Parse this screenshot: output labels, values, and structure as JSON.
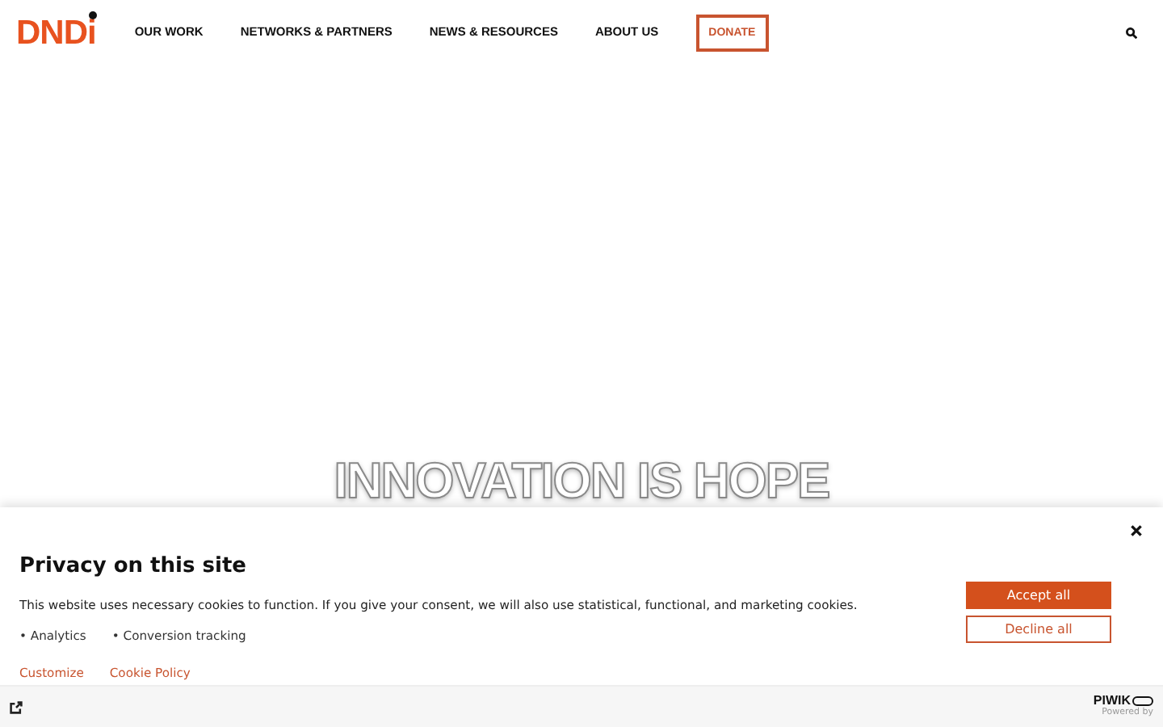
{
  "header": {
    "logo": "DNDi",
    "nav": [
      {
        "label": "OUR WORK"
      },
      {
        "label": "NETWORKS & PARTNERS"
      },
      {
        "label": "NEWS & RESOURCES"
      },
      {
        "label": "ABOUT US"
      }
    ],
    "donate": "DONATE"
  },
  "hero": {
    "headline": "INNOVATION IS HOPE"
  },
  "consent": {
    "title": "Privacy on this site",
    "text": "This website uses necessary cookies to function. If you give your consent, we will also use statistical, functional, and marketing cookies.",
    "purposes": [
      "• Analytics",
      "• Conversion tracking"
    ],
    "links": [
      "Customize",
      "Cookie Policy"
    ],
    "accept": "Accept all",
    "decline": "Decline all",
    "brand": "PIWIK",
    "powered": "Powered by"
  }
}
